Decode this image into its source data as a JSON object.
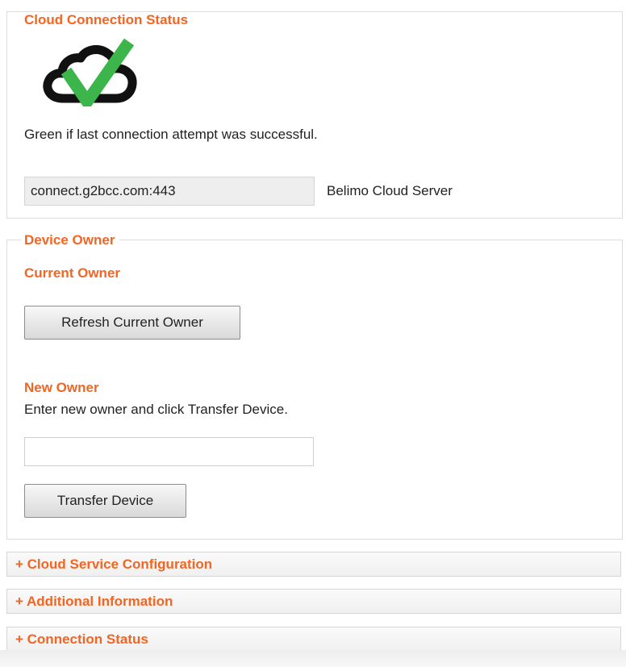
{
  "cloud_connection_status": {
    "legend": "Cloud Connection Status",
    "icon": "cloud-check-icon",
    "description": "Green if last connection attempt was successful.",
    "server_value": "connect.g2bcc.com:443",
    "server_label": "Belimo Cloud Server"
  },
  "device_owner": {
    "legend": "Device Owner",
    "current_owner_heading": "Current Owner",
    "refresh_button_label": "Refresh Current Owner",
    "new_owner_heading": "New Owner",
    "new_owner_instructions": "Enter new owner and click Transfer Device.",
    "new_owner_input_value": "",
    "transfer_button_label": "Transfer Device"
  },
  "collapsed_sections": [
    {
      "label": "+ Cloud Service Configuration"
    },
    {
      "label": "+ Additional Information"
    },
    {
      "label": "+ Connection Status"
    }
  ],
  "colors": {
    "accent": "#f26522",
    "check_green": "#3cb64a",
    "cloud_outline": "#111111"
  }
}
